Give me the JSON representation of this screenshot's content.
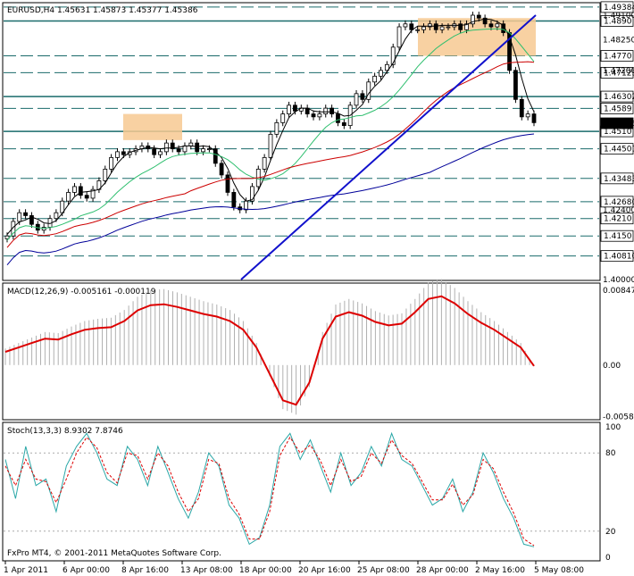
{
  "title": "EURUSD,H4  1.45631 1.45873 1.45377 1.45386",
  "macd_label": "MACD(12,26,9) -0.005161 -0.000119",
  "stoch_label": "Stoch(13,3,3) 8.9302 7.8746",
  "copyright": "FxPro MT4, © 2001-2011 MetaQuotes Software Corp.",
  "colors": {
    "h_line": "#1a6b6b",
    "trend_line": "#1111cc",
    "box_fill": "#f7c992",
    "ma_black": "#000000",
    "ma_green": "#2fbf6f",
    "ma_red": "#cc0000",
    "ma_blue": "#000099",
    "macd_line": "#dd0000",
    "macd_hist": "#b0b0b0",
    "stoch_main": "#2aa7a7",
    "stoch_signal": "#dd0000"
  },
  "chart_data": [
    {
      "type": "candlestick",
      "name": "EURUSD,H4",
      "ylim": [
        1.4,
        1.495
      ],
      "x_ticks": [
        "1 Apr 2011",
        "6 Apr 00:00",
        "8 Apr 16:00",
        "13 Apr 08:00",
        "18 Apr 00:00",
        "20 Apr 16:00",
        "25 Apr 08:00",
        "28 Apr 00:00",
        "2 May 16:00",
        "5 May 08:00"
      ],
      "price_labels": [
        "1.49384",
        "1.4890",
        "1.4770",
        "1.47123",
        "1.46302",
        "1.4589",
        "1.4510",
        "1.44501",
        "1.43483",
        "1.42680",
        "1.4210",
        "1.4150",
        "1.40810"
      ],
      "axis_labels_plain": [
        "1.48250",
        "1.42400"
      ],
      "axis_labels_partial": [
        "1.49100",
        "1.47200",
        "1.45386",
        "1.40000"
      ],
      "current_price": "1.45386",
      "horizontal_levels": [
        1.4938,
        1.489,
        1.477,
        1.4712,
        1.463,
        1.4589,
        1.451,
        1.445,
        1.4348,
        1.4268,
        1.421,
        1.415,
        1.4081
      ],
      "close_series": [
        1.415,
        1.42,
        1.423,
        1.422,
        1.419,
        1.417,
        1.418,
        1.421,
        1.423,
        1.427,
        1.43,
        1.432,
        1.429,
        1.428,
        1.431,
        1.434,
        1.438,
        1.442,
        1.444,
        1.443,
        1.444,
        1.445,
        1.446,
        1.445,
        1.443,
        1.444,
        1.447,
        1.445,
        1.444,
        1.446,
        1.447,
        1.444,
        1.445,
        1.445,
        1.44,
        1.436,
        1.43,
        1.425,
        1.424,
        1.427,
        1.432,
        1.438,
        1.442,
        1.45,
        1.454,
        1.457,
        1.46,
        1.458,
        1.459,
        1.457,
        1.456,
        1.457,
        1.459,
        1.457,
        1.454,
        1.453,
        1.46,
        1.464,
        1.462,
        1.468,
        1.47,
        1.472,
        1.474,
        1.48,
        1.487,
        1.488,
        1.486,
        1.486,
        1.487,
        1.488,
        1.486,
        1.487,
        1.487,
        1.488,
        1.486,
        1.488,
        1.491,
        1.49,
        1.488,
        1.487,
        1.488,
        1.485,
        1.472,
        1.462,
        1.456,
        1.457,
        1.454
      ],
      "box_zones": [
        {
          "x_range": [
            "8 Apr 16:00",
            "13 Apr 08:00"
          ],
          "y_range": [
            1.448,
            1.457
          ]
        },
        {
          "x_range": [
            "28 Apr 00:00",
            "5 May 08:00"
          ],
          "y_range": [
            1.477,
            1.49
          ]
        }
      ],
      "trend_lines": [
        {
          "from": [
            "18 Apr 00:00",
            1.4
          ],
          "to": [
            "5 May 08:00",
            1.491
          ]
        }
      ],
      "moving_averages": [
        "black",
        "green",
        "red",
        "blue"
      ]
    },
    {
      "type": "line",
      "name": "MACD(12,26,9)",
      "values_text": [
        "-0.005161",
        "-0.000119"
      ],
      "ylim": [
        -0.006,
        0.009
      ],
      "y_ticks": [
        "0.00847",
        "0.00",
        "-0.00584"
      ],
      "signal": [
        0.0015,
        0.002,
        0.0025,
        0.003,
        0.0029,
        0.0035,
        0.004,
        0.0042,
        0.0043,
        0.005,
        0.0062,
        0.0068,
        0.0069,
        0.0066,
        0.0062,
        0.0058,
        0.0055,
        0.005,
        0.004,
        0.002,
        -0.001,
        -0.004,
        -0.0045,
        -0.002,
        0.003,
        0.0055,
        0.006,
        0.0056,
        0.0049,
        0.0045,
        0.0047,
        0.006,
        0.0075,
        0.0078,
        0.007,
        0.0058,
        0.0048,
        0.004,
        0.003,
        0.002,
        -0.0001
      ]
    },
    {
      "type": "line",
      "name": "Stoch(13,3,3)",
      "values_text": [
        "8.9302",
        "7.8746"
      ],
      "ylim": [
        0,
        100
      ],
      "y_ticks": [
        "100",
        "80",
        "20",
        "0"
      ],
      "main": [
        75,
        45,
        85,
        55,
        60,
        35,
        70,
        85,
        95,
        80,
        60,
        55,
        85,
        75,
        55,
        85,
        65,
        45,
        30,
        50,
        80,
        70,
        40,
        30,
        10,
        15,
        40,
        85,
        95,
        75,
        90,
        70,
        50,
        80,
        55,
        65,
        85,
        70,
        95,
        75,
        70,
        55,
        40,
        45,
        60,
        35,
        50,
        80,
        65,
        45,
        30,
        10,
        8
      ],
      "signal": [
        70,
        55,
        75,
        60,
        58,
        42,
        60,
        80,
        92,
        84,
        65,
        57,
        80,
        78,
        60,
        80,
        70,
        50,
        35,
        45,
        75,
        72,
        45,
        33,
        14,
        14,
        35,
        78,
        92,
        80,
        86,
        74,
        55,
        75,
        58,
        62,
        80,
        72,
        90,
        78,
        72,
        58,
        44,
        44,
        56,
        40,
        48,
        75,
        68,
        50,
        34,
        14,
        9
      ]
    }
  ]
}
